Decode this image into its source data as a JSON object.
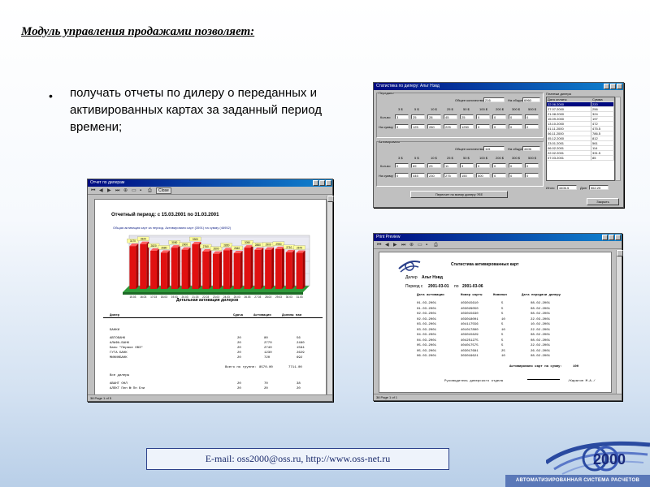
{
  "slide": {
    "title": "Модуль управления продажами позволяет:",
    "bullet_char": "•",
    "bullet_text": "получать отчеты по  дилеру о переданных и активированных картах за заданный период времени;",
    "contact": "E-mail: oss2000@oss.ru,  http://www.oss-net.ru",
    "logo_text": "2000",
    "logo_caption": "АВТОМАТИЗИРОВАННАЯ СИСТЕМА РАСЧЕТОВ"
  },
  "stats_window": {
    "title": "Статистика по дилеру:  Альт Нэвд",
    "transfer_label": "Передано",
    "activation_label": "Активировано",
    "total_qty_label": "Общее количество",
    "total_sum_label": "На общую сумму $",
    "transfer_qty": "216",
    "transfer_sum": "6960",
    "activation_qty": "115",
    "activation_sum": "4406",
    "denominations": [
      "3 $",
      "5 $",
      "10 $",
      "25 $",
      "50 $",
      "100 $",
      "200 $",
      "300 $",
      "500 $"
    ],
    "qty_label": "Кол-во",
    "sum_label": "На сумму",
    "transfer_qty_row": [
      "3",
      "25",
      "28",
      "45",
      "25",
      "0",
      "0",
      "0",
      "0"
    ],
    "transfer_sum_row": [
      "9",
      "125",
      "280",
      "225",
      "1250",
      "0",
      "0",
      "0",
      "0"
    ],
    "activation_qty_row": [
      "0",
      "69",
      "23",
      "11",
      "3",
      "0",
      "0",
      "0",
      "0"
    ],
    "activation_sum_row": [
      "0",
      "445",
      "230",
      "275",
      "150",
      "500",
      "0",
      "0",
      "0"
    ],
    "refresh_button": "Пересчет по всему дилеру ?ЕЕ",
    "payments_label": "Платежи дилера",
    "payments_headers": [
      "Дата оплаты",
      "Сумма"
    ],
    "payments_rows": [
      [
        "22.06.2000",
        "220"
      ],
      [
        "27.07.2000",
        "256"
      ],
      [
        "21.08.2000",
        "324"
      ],
      [
        "15.09.2000",
        "197"
      ],
      [
        "13.10.2000",
        "472"
      ],
      [
        "01.11.2000",
        "475.5"
      ],
      [
        "06.11.2000",
        "786.5"
      ],
      [
        "05.12.2000",
        "812"
      ],
      [
        "23.01.2001",
        "561"
      ],
      [
        "06.02.2001",
        "114"
      ],
      [
        "22.02.2001",
        "331.5"
      ],
      [
        "07.03.2001",
        "85"
      ]
    ],
    "total_label": "Итого",
    "total_value": "4406.5",
    "debt_label": "Долг",
    "debt_value": "562.25",
    "close_button": "Закрыть"
  },
  "report_window": {
    "title": "Отчет по дилерам",
    "close_button": "Close",
    "period": "Отчетный период: с 15.03.2001 по 31.03.2001",
    "subtitle": "Общая активация карт за период. Активировано карт (3591) на сумму (46952)",
    "chart_title": "Детальная активация дилеров",
    "columns": [
      "Дилер",
      "Сдача",
      "Активация",
      "Должны нам"
    ],
    "group1": "БАНКИ",
    "rows": [
      [
        "АВТОБАНК",
        "20",
        "80",
        "56"
      ],
      [
        "АЛЬФА-БАНК",
        "20",
        "2770",
        "2480"
      ],
      [
        "Банк \"Первое ОВЗ\"",
        "20",
        "2740",
        "1584"
      ],
      [
        "ГУТА БАНК",
        "20",
        "1230",
        "2629"
      ],
      [
        "МИНИНБАНК",
        "20",
        "720",
        "692"
      ]
    ],
    "subtotal_label": "Всего по группе:",
    "subtotal_values": [
      "8570.00",
      "7711.00"
    ],
    "group2": "Все дилеры",
    "rows2": [
      [
        "АВАНТ ОНЛ",
        "20",
        "70",
        "38"
      ],
      [
        "АЛЕКТ Плп № Пп Ели",
        "20",
        "20",
        "20"
      ]
    ],
    "page_label": "38  Page 1 of 5"
  },
  "chart_data": {
    "type": "bar",
    "title": "",
    "categories": [
      "15.03",
      "16.03",
      "17.03",
      "18.03",
      "19.03",
      "20.03",
      "21.03",
      "22.03",
      "23.03",
      "24.03",
      "25.03",
      "26.03",
      "27.03",
      "28.03",
      "29.03",
      "30.03",
      "31.03"
    ],
    "values": [
      3170,
      3320,
      2820,
      2680,
      3050,
      2900,
      3300,
      2760,
      2600,
      2850,
      2640,
      3050,
      2880,
      2900,
      2950,
      2710,
      2670
    ],
    "ylim": [
      0,
      3600
    ],
    "bar_color": "#e01010"
  },
  "activation_window": {
    "title": "Print Preview",
    "heading": "Статистика активированных карт",
    "dealer_label": "Дилер",
    "dealer_value": "Альт Нэвд",
    "period_label": "Период с",
    "period_from": "2001-03-01",
    "period_to_label": "по",
    "period_to": "2001-03-06",
    "columns": [
      "Дата активации",
      "Номер карты",
      "Номинал",
      "Дата передачи дилеру"
    ],
    "rows": [
      [
        "01.03.2001",
        "403015610",
        "5",
        "08.02.2001"
      ],
      [
        "01.03.2001",
        "403029050",
        "5",
        "08.02.2001"
      ],
      [
        "02.03.2001",
        "403015630",
        "5",
        "08.02.2001"
      ],
      [
        "02.03.2001",
        "403018001",
        "10",
        "22.03.2001"
      ],
      [
        "03.03.2001",
        "404117556",
        "5",
        "10.02.2001"
      ],
      [
        "03.03.2001",
        "401017800",
        "10",
        "22.02.2001"
      ],
      [
        "04.03.2001",
        "403015629",
        "5",
        "08.02.2001"
      ],
      [
        "04.03.2001",
        "404251275",
        "5",
        "08.02.2001"
      ],
      [
        "05.03.2001",
        "404017575",
        "5",
        "22.02.2001"
      ],
      [
        "05.03.2001",
        "403017681",
        "25",
        "26.02.2001"
      ],
      [
        "06.03.2001",
        "303019621",
        "10",
        "08.02.2001"
      ]
    ],
    "total_label": "Активировано карт на сумму:",
    "total_value": "100",
    "signature_label": "Руководитель дилерского отдела",
    "signature_name": "/Карагин М.А./",
    "page_label": "38  Page 1 of 1"
  }
}
